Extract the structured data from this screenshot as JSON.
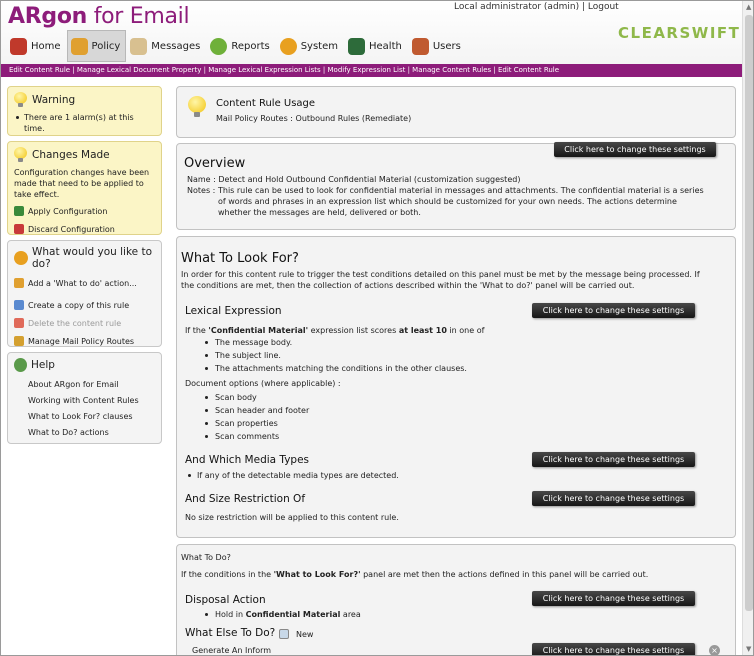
{
  "app": {
    "logo_brand": "ARgon",
    "logo_suffix": "for Email",
    "user_bar": "Local administrator (admin) | Logout",
    "vendor": "CLEARSWIFT"
  },
  "nav": [
    {
      "label": "Home",
      "icon": "home-icon",
      "color": "#c0392b"
    },
    {
      "label": "Policy",
      "icon": "policy-icon",
      "color": "#e0a030",
      "active": true
    },
    {
      "label": "Messages",
      "icon": "messages-icon",
      "color": "#d8c090"
    },
    {
      "label": "Reports",
      "icon": "reports-icon",
      "color": "#6fb03a"
    },
    {
      "label": "System",
      "icon": "system-icon",
      "color": "#e8a020"
    },
    {
      "label": "Health",
      "icon": "health-icon",
      "color": "#2d6b3a"
    },
    {
      "label": "Users",
      "icon": "users-icon",
      "color": "#c05a30"
    }
  ],
  "breadcrumb": "Edit Content Rule | Manage Lexical Document Property | Manage Lexical Expression Lists | Modify Expression List | Manage Content Rules | Edit Content Rule",
  "sidebar": {
    "warning": {
      "title": "Warning",
      "text": "There are 1 alarm(s) at this time."
    },
    "changes": {
      "title": "Changes Made",
      "text": "Configuration changes have been made that need to be applied to take effect.",
      "apply": "Apply Configuration",
      "discard": "Discard Configuration"
    },
    "todo": {
      "title": "What would you like to do?",
      "add": "Add a 'What to do' action...",
      "copy": "Create a copy of this rule",
      "delete": "Delete the content rule",
      "manage": "Manage Mail Policy Routes"
    },
    "help": {
      "title": "Help",
      "items": [
        "About ARgon for Email",
        "Working with Content Rules",
        "What to Look For? clauses",
        "What to Do? actions"
      ]
    }
  },
  "usage": {
    "title": "Content Rule Usage",
    "routes": "Mail Policy Routes : Outbound Rules (Remediate)"
  },
  "overview": {
    "title": "Overview",
    "button": "Click here to change these settings",
    "name_label": "Name :",
    "name_value": "Detect and Hold Outbound Confidential Material (customization suggested)",
    "notes_label": "Notes :",
    "notes_line1": "This rule can be used to look for confidential material in messages and attachments. The confidential material is a series",
    "notes_line2": "of words and phrases in an expression list which should be customized for your own needs. The actions determine",
    "notes_line3": "whether the messages are held, delivered or both."
  },
  "look": {
    "title": "What To Look For?",
    "intro1": "In order for this content rule to trigger the test conditions detailed on this panel must be met by the message being processed. If",
    "intro2": "the conditions are met, then the collection of actions described within the 'What to do?' panel will be carried out.",
    "lexical_title": "Lexical Expression",
    "lexical_button": "Click here to change these settings",
    "lexical_rule_pre": "If the ",
    "lexical_rule_list": "'Confidential Material'",
    "lexical_rule_mid": " expression list scores ",
    "lexical_rule_score": "at least 10",
    "lexical_rule_post": " in one of",
    "lexical_items": [
      "The message body.",
      "The subject line.",
      "The attachments matching the conditions in the other clauses."
    ],
    "doc_options": "Document options (where applicable) :",
    "doc_items": [
      "Scan body",
      "Scan header and footer",
      "Scan properties",
      "Scan comments"
    ],
    "media_title": "And Which Media Types",
    "media_button": "Click here to change these settings",
    "media_item": "If any of the detectable media types are detected.",
    "size_title": "And Size Restriction Of",
    "size_button": "Click here to change these settings",
    "size_text": "No size restriction will be applied to this content rule."
  },
  "todo": {
    "label": "What To Do?",
    "intro_pre": "If the conditions in the ",
    "intro_ref": "'What to Look For?'",
    "intro_post": " panel are met then the actions defined in this panel will be carried out.",
    "disposal_title": "Disposal Action",
    "disposal_button": "Click here to change these settings",
    "disposal_pre": "Hold in ",
    "disposal_area": "Confidential Material",
    "disposal_post": " area",
    "else_title": "What Else To Do?",
    "new_label": "New",
    "inform_label": "Generate An Inform",
    "inform_button": "Click here to change these settings"
  }
}
